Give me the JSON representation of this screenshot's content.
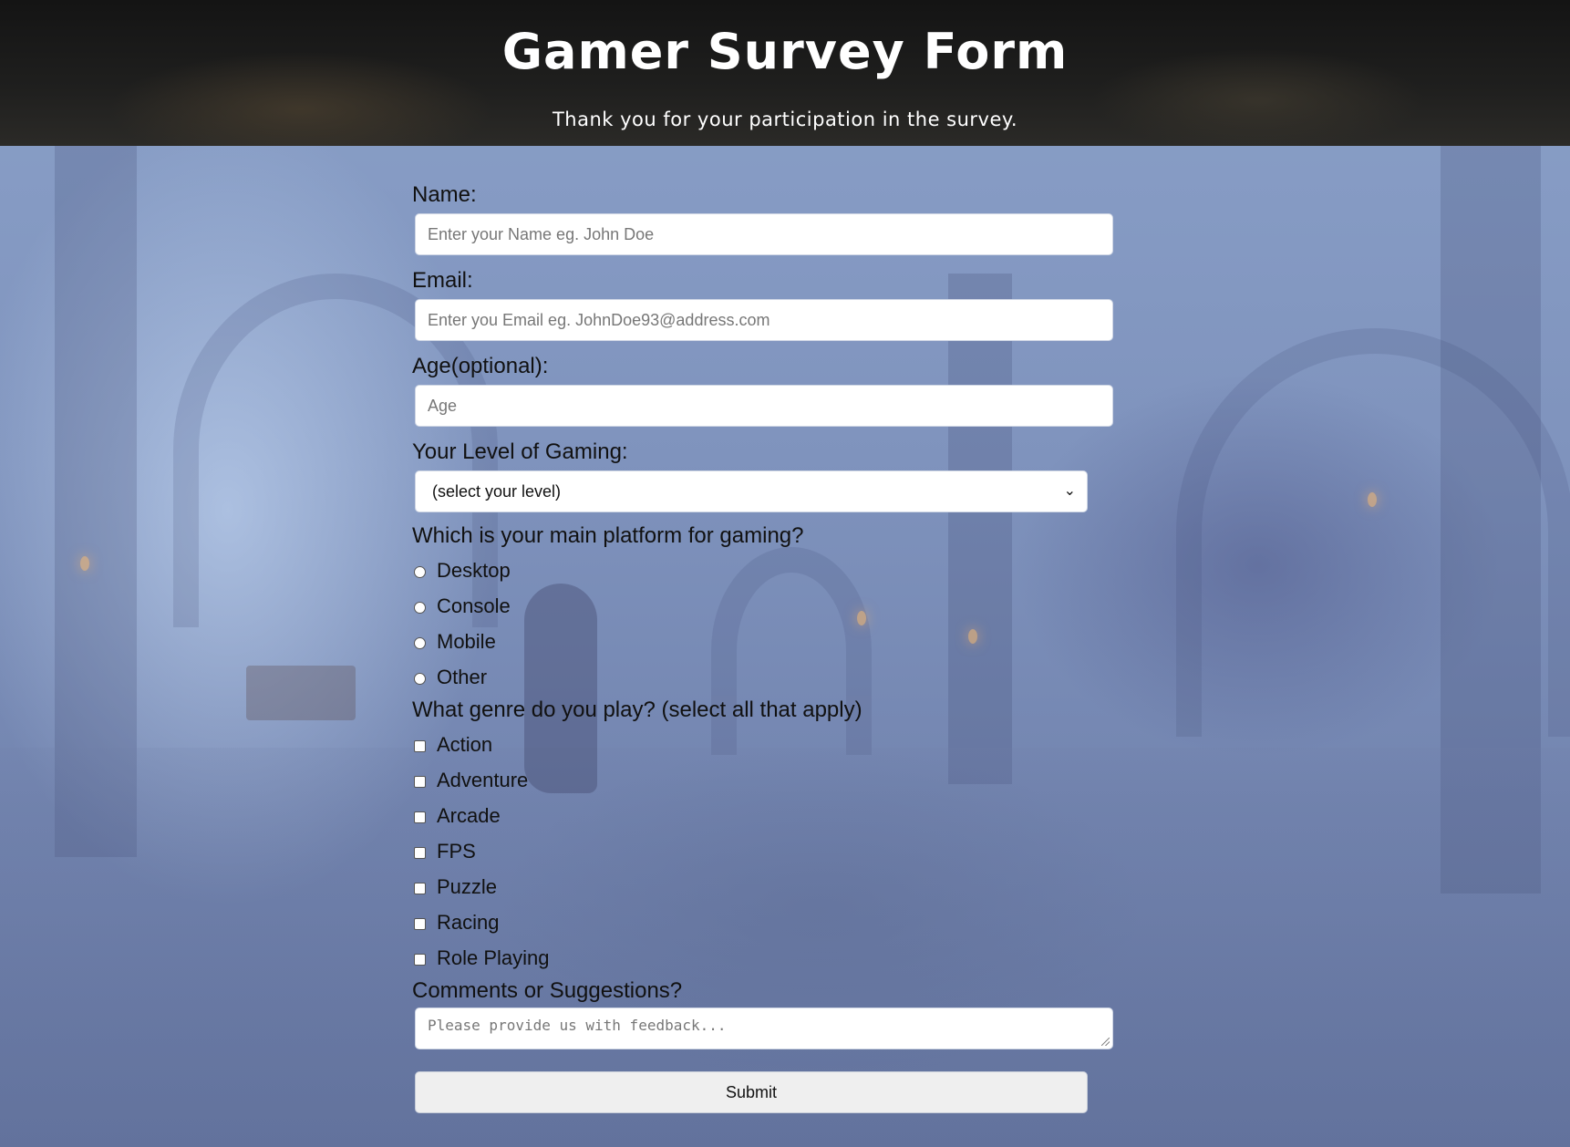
{
  "header": {
    "title": "Gamer Survey Form",
    "description": "Thank you for your participation in the survey."
  },
  "form": {
    "name": {
      "label": "Name:",
      "placeholder": "Enter your Name eg. John Doe",
      "value": ""
    },
    "email": {
      "label": "Email:",
      "placeholder": "Enter you Email eg. JohnDoe93@address.com",
      "value": ""
    },
    "age": {
      "label": "Age(optional):",
      "placeholder": "Age",
      "value": ""
    },
    "level": {
      "label": "Your Level of Gaming:",
      "selected": "(select your level)"
    },
    "platform": {
      "label": "Which is your main platform for gaming?",
      "options": [
        "Desktop",
        "Console",
        "Mobile",
        "Other"
      ]
    },
    "genre": {
      "label": "What genre do you play? (select all that apply)",
      "options": [
        "Action",
        "Adventure",
        "Arcade",
        "FPS",
        "Puzzle",
        "Racing",
        "Role Playing"
      ]
    },
    "comments": {
      "label": "Comments or Suggestions?",
      "placeholder": "Please provide us with feedback..."
    },
    "submit_label": "Submit"
  },
  "icons": {
    "select_arrow": "chevron-down-icon",
    "textarea_resize": "resize-grip-icon"
  },
  "colors": {
    "banner_bg": "#1f1f1e",
    "overlay_blue": "#7d8fb7",
    "input_bg": "#ffffff",
    "button_bg": "#efefef"
  }
}
